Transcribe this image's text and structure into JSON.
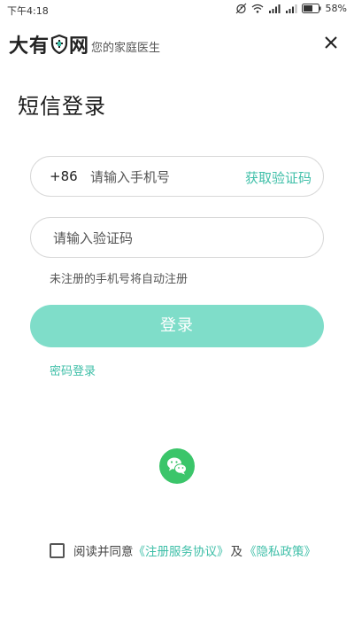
{
  "status_bar": {
    "time": "下午4:18",
    "battery": "58%"
  },
  "header": {
    "logo_part1": "大有",
    "logo_part2": "网",
    "slogan": "您的家庭医生"
  },
  "page_title": "短信登录",
  "phone_field": {
    "country_code": "+86",
    "placeholder": "请输入手机号",
    "get_code_label": "获取验证码"
  },
  "code_field": {
    "placeholder": "请输入验证码"
  },
  "hint": "未注册的手机号将自动注册",
  "login_button": "登录",
  "password_login": "密码登录",
  "agreement": {
    "prefix": "阅读并同意",
    "service_link": "《注册服务协议》",
    "and": "及",
    "privacy_link": "《隐私政策》"
  },
  "colors": {
    "accent": "#3fbfa8",
    "login_button": "#7fddc9",
    "wechat": "#3bc56a"
  },
  "icons": {
    "close": "close-icon",
    "wechat": "wechat-icon",
    "shield": "shield-icon"
  }
}
